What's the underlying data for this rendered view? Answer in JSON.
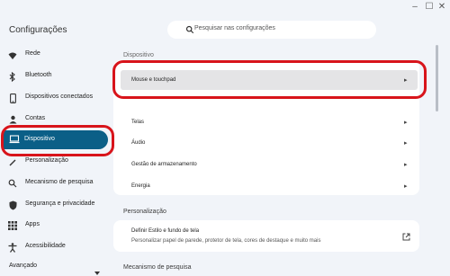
{
  "window": {
    "controls": {
      "minimize": "–",
      "maximize": "☐",
      "close": "✕"
    }
  },
  "app": {
    "title": "Configurações"
  },
  "search": {
    "placeholder": "Pesquisar nas configurações"
  },
  "sidebar": {
    "items": [
      {
        "label": "Rede",
        "icon": "wifi-icon"
      },
      {
        "label": "Bluetooth",
        "icon": "bluetooth-icon"
      },
      {
        "label": "Dispositivos conectados",
        "icon": "phone-icon"
      },
      {
        "label": "Contas",
        "icon": "person-icon"
      },
      {
        "label": "Dispositivo",
        "icon": "laptop-icon",
        "selected": true
      },
      {
        "label": "Personalização",
        "icon": "brush-icon"
      },
      {
        "label": "Mecanismo de pesquisa",
        "icon": "search-icon"
      },
      {
        "label": "Segurança e privacidade",
        "icon": "shield-icon"
      },
      {
        "label": "Apps",
        "icon": "apps-grid-icon"
      },
      {
        "label": "Acessibilidade",
        "icon": "accessibility-icon"
      },
      {
        "label": "Avançado",
        "icon": "chevron-down-icon"
      }
    ]
  },
  "main": {
    "device_section_title": "Dispositivo",
    "device_rows": [
      {
        "label": "Mouse e touchpad"
      },
      {
        "label": "Telas"
      },
      {
        "label": "Áudio"
      },
      {
        "label": "Gestão de armazenamento"
      },
      {
        "label": "Energia"
      }
    ],
    "personalization_title": "Personalização",
    "wallpaper_row": {
      "title": "Definir Estilo e fundo de tela",
      "subtitle": "Personalizar papel de parede, protetor de tela, cores de destaque e muito mais"
    },
    "search_engine_title": "Mecanismo de pesquisa"
  },
  "colors": {
    "accent": "#0b5f87",
    "highlight": "#d8141b",
    "background": "#f1f4f9"
  }
}
